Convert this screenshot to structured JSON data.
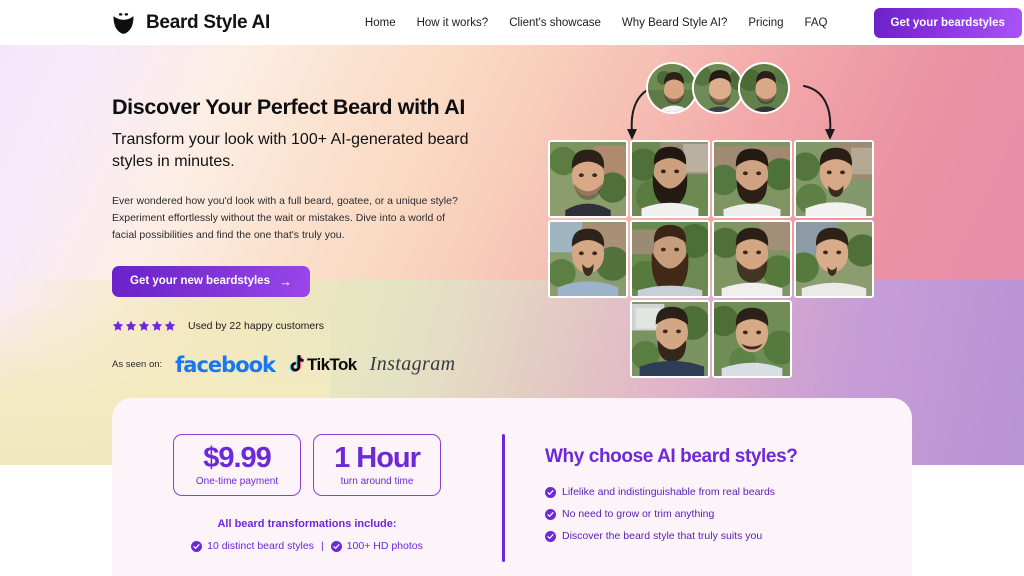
{
  "brand": {
    "name": "Beard Style AI",
    "logo_icon": "beard-logo-icon"
  },
  "nav": {
    "links": [
      {
        "label": "Home"
      },
      {
        "label": "How it works?"
      },
      {
        "label": "Client's showcase"
      },
      {
        "label": "Why Beard Style AI?"
      },
      {
        "label": "Pricing"
      },
      {
        "label": "FAQ"
      }
    ],
    "cta_label": "Get your beardstyles"
  },
  "hero": {
    "headline": "Discover Your Perfect Beard with AI",
    "subheadline": "Transform your look with 100+ AI-generated beard styles in minutes.",
    "paragraph": "Ever wondered how you'd look with a full beard, goatee, or a unique style? Experiment effortlessly without the wait or mistakes. Dive into a world of facial possibilities and find the one that's truly you.",
    "cta_label": "Get your new beardstyles",
    "cta_arrow": "→",
    "stars": 5,
    "star_color": "#6d28d9",
    "rating_text": "Used by 22 happy customers",
    "as_seen_label": "As seen on:",
    "logos": [
      {
        "name": "facebook",
        "label": "facebook",
        "color": "#1877f2"
      },
      {
        "name": "tiktok",
        "label": "TikTok",
        "color": "#0b0b0d"
      },
      {
        "name": "instagram",
        "label": "Instagram",
        "color": "#3b3b3f"
      }
    ]
  },
  "showcase": {
    "avatars": [
      {
        "alt": "source-photo-1"
      },
      {
        "alt": "source-photo-2"
      },
      {
        "alt": "source-photo-3"
      }
    ],
    "grid": [
      {
        "alt": "beard-result-1",
        "style": "light-stubble"
      },
      {
        "alt": "beard-result-2",
        "style": "full-beard"
      },
      {
        "alt": "beard-result-3",
        "style": "short-boxed-beard"
      },
      {
        "alt": "beard-result-4",
        "style": "goatee"
      },
      {
        "alt": "beard-result-5",
        "style": "van-dyke"
      },
      {
        "alt": "beard-result-6",
        "style": "long-full-beard"
      },
      {
        "alt": "beard-result-7",
        "style": "medium-stubble"
      },
      {
        "alt": "beard-result-8",
        "style": "soul-patch"
      },
      {
        "alt": "beard-result-9",
        "style": "chinstrap-beard"
      },
      {
        "alt": "beard-result-10",
        "style": "mustache"
      }
    ]
  },
  "card": {
    "price": {
      "amount": "$9.99",
      "caption": "One-time payment"
    },
    "turnaround": {
      "amount": "1 Hour",
      "caption": "turn around time"
    },
    "include_title": "All beard transformations include:",
    "include_items": [
      {
        "label": "10 distinct beard styles"
      },
      {
        "label": "100+ HD photos"
      }
    ],
    "include_separator": "|",
    "why_title": "Why choose AI beard styles?",
    "why_items": [
      {
        "label": "Lifelike and indistinguishable from real beards"
      },
      {
        "label": "No need to grow or trim anything"
      },
      {
        "label": "Discover the beard style that truly suits you"
      }
    ]
  },
  "colors": {
    "accent_purple": "#6d28d9",
    "accent_purple_light": "#a855f7",
    "card_bg": "#fdf4fa",
    "facebook_blue": "#1877f2"
  }
}
